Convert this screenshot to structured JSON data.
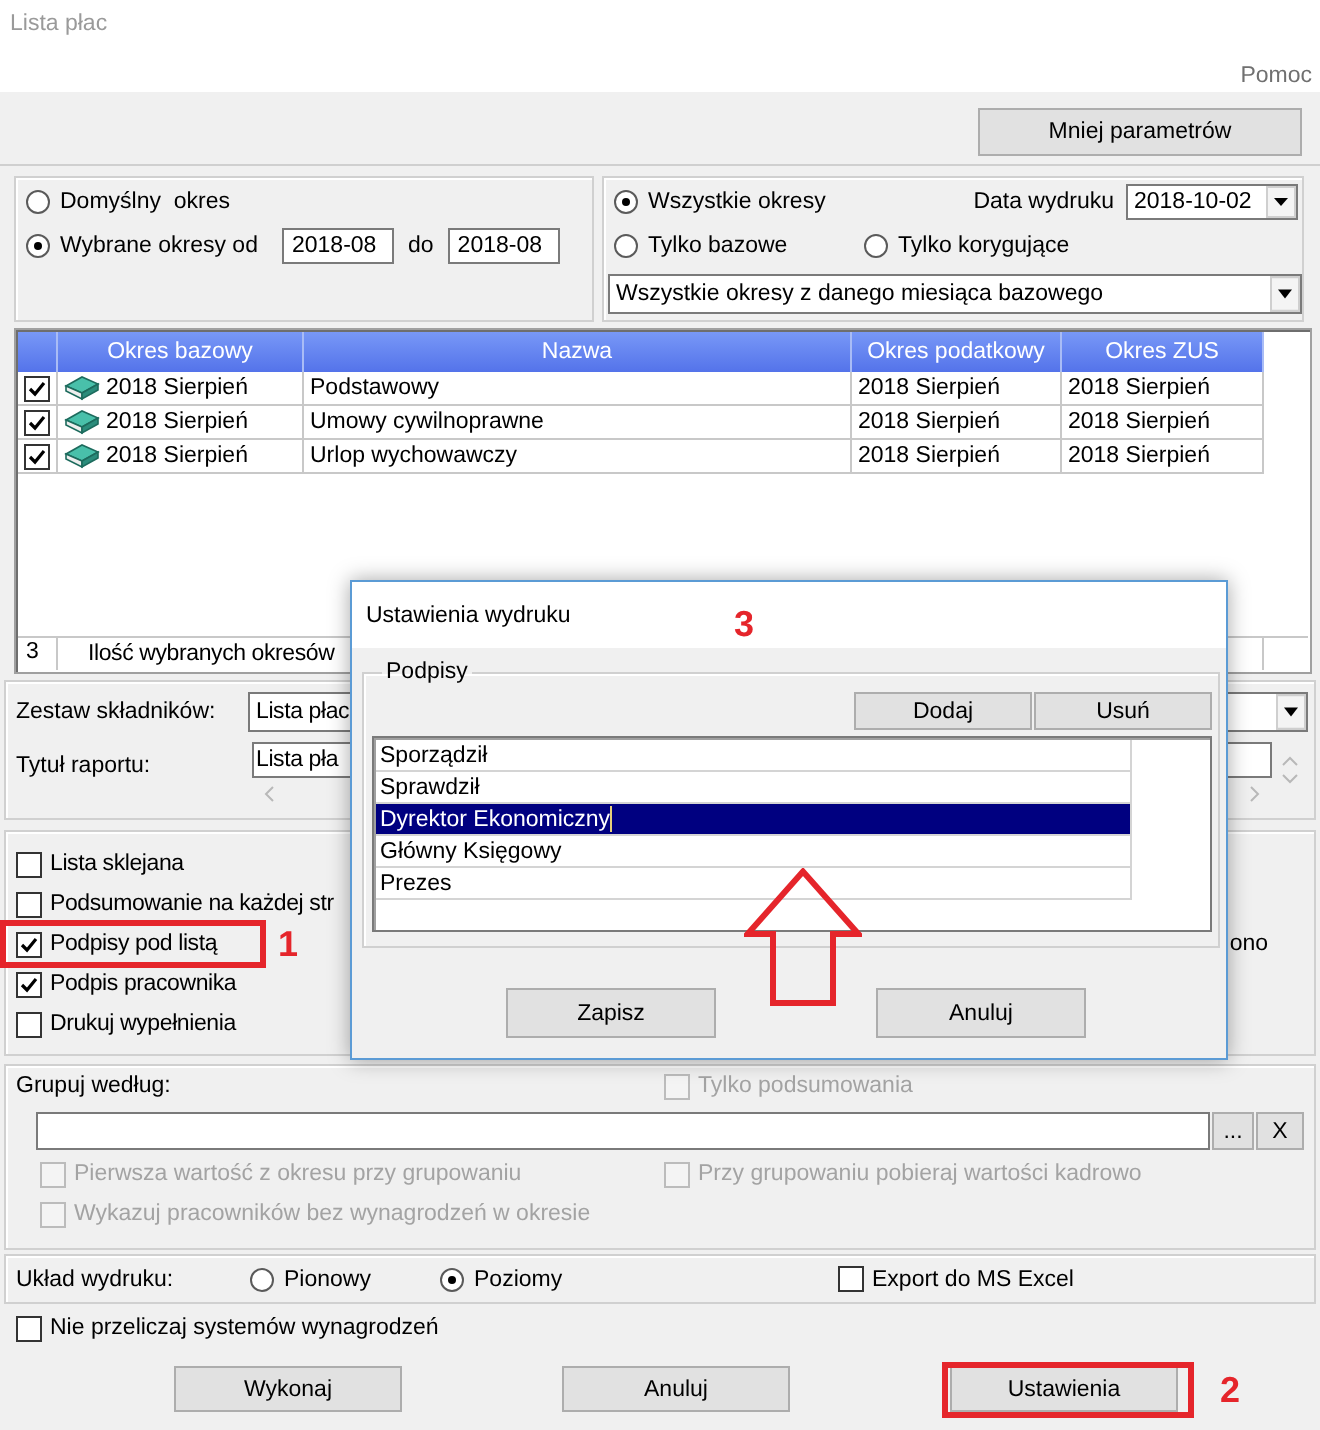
{
  "window": {
    "title": "Lista płac",
    "help_menu": "Pomoc"
  },
  "toolbar": {
    "toggle_button": "Mniej parametrów"
  },
  "period": {
    "options": [
      {
        "label": "Domyślny  okres",
        "selected": false
      },
      {
        "label": "Wybrane okresy od",
        "selected": true
      }
    ],
    "from": "2018-08",
    "to_label": "do",
    "to": "2018-08"
  },
  "scope": {
    "options": [
      {
        "label": "Wszystkie okresy",
        "selected": true
      },
      {
        "label": "Tylko bazowe",
        "selected": false
      },
      {
        "label": "Tylko korygujące",
        "selected": false
      }
    ],
    "print_date_label": "Data wydruku",
    "print_date": "2018-10-02",
    "filter": "Wszystkie okresy z danego miesiąca bazowego"
  },
  "table": {
    "columns": [
      "Okres bazowy",
      "Nazwa",
      "Okres podatkowy",
      "Okres ZUS"
    ],
    "rows": [
      {
        "checked": true,
        "cells": [
          "2018 Sierpień",
          "Podstawowy",
          "2018 Sierpień",
          "2018 Sierpień"
        ]
      },
      {
        "checked": true,
        "cells": [
          "2018 Sierpień",
          "Umowy cywilnoprawne",
          "2018 Sierpień",
          "2018 Sierpień"
        ]
      },
      {
        "checked": true,
        "cells": [
          "2018 Sierpień",
          "Urlop wychowawczy",
          "2018 Sierpień",
          "2018 Sierpień"
        ]
      }
    ],
    "footer": {
      "count": "3",
      "label": "Ilość wybranych okresów"
    }
  },
  "report": {
    "components_label": "Zestaw składników:",
    "components": "Lista płac",
    "title_label": "Tytuł raportu:",
    "title": "Lista pła"
  },
  "options": {
    "items": [
      {
        "label": "Lista sklejana",
        "checked": false
      },
      {
        "label": "Podsumowanie na każdej str",
        "checked": false
      },
      {
        "label": "Podpisy pod listą",
        "checked": true,
        "callout": "1"
      },
      {
        "label": "Podpis pracownika",
        "checked": true
      },
      {
        "label": "Drukuj wypełnienia",
        "checked": false
      }
    ],
    "right_fragment": "ono"
  },
  "grouping": {
    "label": "Grupuj według:",
    "summary_only": {
      "label": "Tylko podsumowania",
      "checked": false,
      "disabled": true
    },
    "browse_button": "...",
    "clear_button": "X",
    "options": [
      {
        "label": "Pierwsza wartość z okresu przy grupowaniu",
        "checked": false,
        "disabled": true
      },
      {
        "label": "Przy grupowaniu pobieraj wartości kadrowo",
        "checked": false,
        "disabled": true
      },
      {
        "label": "Wykazuj pracowników bez wynagrodzeń w okresie",
        "checked": false,
        "disabled": true
      }
    ]
  },
  "layout": {
    "label": "Układ wydruku:",
    "orientation": [
      {
        "label": "Pionowy",
        "selected": false
      },
      {
        "label": "Poziomy",
        "selected": true
      }
    ],
    "excel": {
      "label": "Export do MS Excel",
      "checked": false
    }
  },
  "no_recalc": {
    "label": "Nie przeliczaj systemów wynagrodzeń",
    "checked": false
  },
  "buttons": [
    {
      "label": "Wykonaj"
    },
    {
      "label": "Anuluj"
    },
    {
      "label": "Ustawienia",
      "callout": "2"
    }
  ],
  "dialog": {
    "title": "Ustawienia wydruku",
    "callout": "3",
    "group": "Podpisy",
    "add_button": "Dodaj",
    "remove_button": "Usuń",
    "items": [
      {
        "label": "Sporządził",
        "selected": false,
        "editing": false
      },
      {
        "label": "Sprawdził",
        "selected": false,
        "editing": false
      },
      {
        "label": "Dyrektor Ekonomiczny",
        "selected": true,
        "editing": true
      },
      {
        "label": "Główny Księgowy",
        "selected": false,
        "editing": false
      },
      {
        "label": "Prezes",
        "selected": false,
        "editing": false
      }
    ],
    "pointer_arrow": true,
    "buttons": [
      "Zapisz",
      "Anuluj"
    ]
  }
}
